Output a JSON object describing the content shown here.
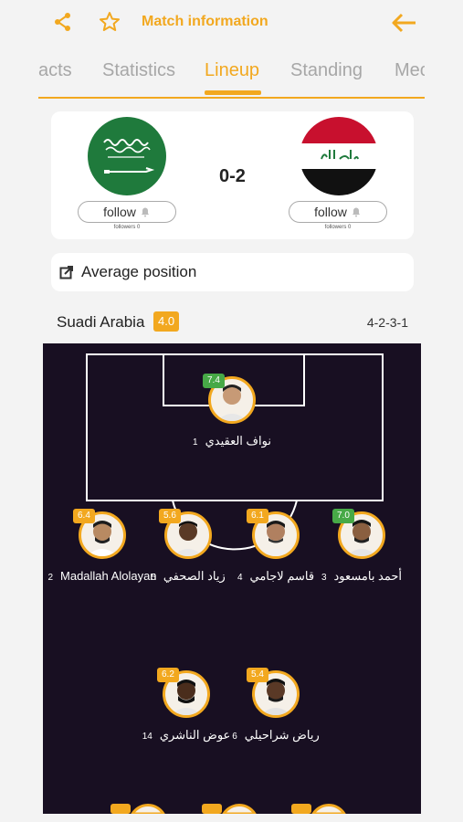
{
  "header": {
    "title": "Match information",
    "icons": [
      "share-icon",
      "star-icon",
      "back-arrow-icon"
    ],
    "accent": "#f2a81f"
  },
  "tabs": [
    "acts",
    "Statistics",
    "Lineup",
    "Standing",
    "Mec"
  ],
  "active_tab": "Lineup",
  "match": {
    "score": "0-2",
    "home": {
      "follow_label": "follow",
      "followers_label": "followers 0"
    },
    "away": {
      "follow_label": "follow",
      "followers_label": "followers 0"
    }
  },
  "average_position_label": "Average position",
  "team": {
    "name": "Suadi Arabia",
    "rating": "4.0",
    "formation": "4-2-3-1"
  },
  "players": [
    {
      "rating": "7.4",
      "rating_color": "green",
      "number": "1",
      "name": "نواف العقيدي"
    },
    {
      "rating": "6.4",
      "rating_color": "orange",
      "number": "2",
      "name": "Madallah Alolayan"
    },
    {
      "rating": "5.6",
      "rating_color": "orange",
      "number": "5",
      "name": "زياد الصحفي"
    },
    {
      "rating": "6.1",
      "rating_color": "orange",
      "number": "4",
      "name": "قاسم لاجامي"
    },
    {
      "rating": "7.0",
      "rating_color": "green",
      "number": "3",
      "name": "أحمد بامسعود"
    },
    {
      "rating": "6.2",
      "rating_color": "orange",
      "number": "14",
      "name": "عوض الناشري"
    },
    {
      "rating": "5.4",
      "rating_color": "orange",
      "number": "6",
      "name": "رياض شراحيلي"
    }
  ]
}
